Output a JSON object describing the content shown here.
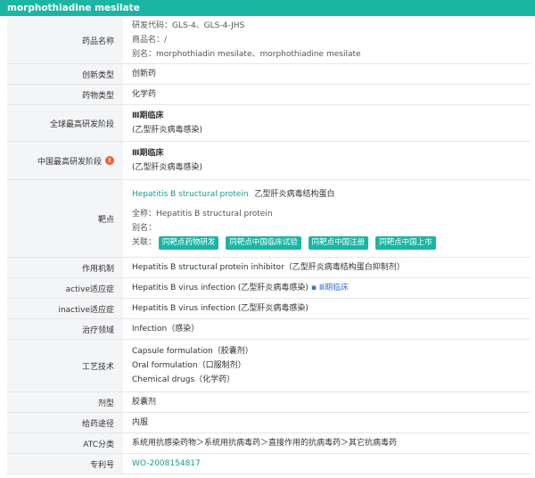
{
  "title": "morphothiadine mesilate",
  "rows": {
    "drug_name": {
      "label": "药品名称",
      "code": "研发代码：GLS-4、GLS-4-JHS",
      "trade": "商品名：/",
      "alias": "别名：morphothiadin mesilate、morphothiadine mesilate"
    },
    "innovation": {
      "label": "创新类型",
      "value": "创新药"
    },
    "drug_type": {
      "label": "药物类型",
      "value": "化学药"
    },
    "global_phase": {
      "label": "全球最高研发阶段",
      "phase": "Ⅲ期临床",
      "indication": "(乙型肝炎病毒感染)"
    },
    "china_phase": {
      "label": "中国最高研发阶段",
      "icon": "!",
      "phase": "Ⅲ期临床",
      "indication": "(乙型肝炎病毒感染)"
    },
    "target": {
      "label": "靶点",
      "name_en": "Hepatitis B structural protein",
      "name_cn": "乙型肝炎病毒结构蛋白",
      "fullname": "全称：Hepatitis B structural protein",
      "alias": "别名：",
      "related_label": "关联：",
      "tags": [
        "同靶点药物研发",
        "同靶点中国临床试验",
        "同靶点中国注册",
        "同靶点中国上市"
      ]
    },
    "mechanism": {
      "label": "作用机制",
      "value": "Hepatitis B structural protein inhibitor（乙型肝炎病毒结构蛋白抑制剂）"
    },
    "active_ind": {
      "label": "active适应症",
      "value": "Hepatitis B virus infection (乙型肝炎病毒感染)",
      "sep": "▪",
      "phase": "Ⅲ期临床"
    },
    "inactive_ind": {
      "label": "inactive适应症",
      "value": "Hepatitis B virus infection (乙型肝炎病毒感染)"
    },
    "therapy": {
      "label": "治疗领域",
      "value": "Infection（感染）"
    },
    "process": {
      "label": "工艺技术",
      "items": [
        "Capsule formulation（胶囊剂）",
        "Oral formulation（口服制剂）",
        "Chemical drugs（化学药）"
      ]
    },
    "dosage": {
      "label": "剂型",
      "value": "胶囊剂"
    },
    "route": {
      "label": "给药途径",
      "value": "内服"
    },
    "atc": {
      "label": "ATC分类",
      "value": "系统用抗感染药物＞系统用抗病毒药＞直接作用的抗病毒药＞其它抗病毒药"
    },
    "patent": {
      "label": "专利号",
      "value": "WO-2008154817"
    }
  },
  "colors": {
    "title_bar": "#1bb5a3",
    "label_bg": "#f4f5f7",
    "tag_bg": "#1bb5a3",
    "warn": "#e8663b"
  }
}
